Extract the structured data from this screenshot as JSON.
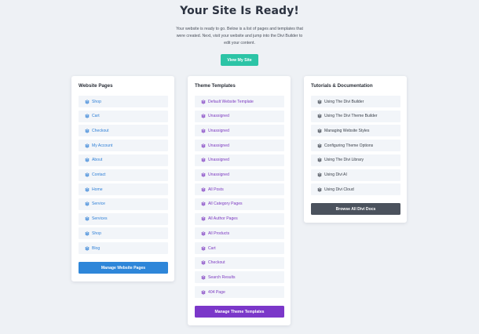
{
  "page": {
    "title": "Your Site Is Ready!",
    "description_line1": "Your website is ready to go. Below is a list of pages and templates that",
    "description_line2": "were created. Next, visit your website and jump into the Divi Builder to",
    "description_line3": "edit your content.",
    "view_site_label": "View My Site"
  },
  "colors": {
    "background": "#eef1f5",
    "accent_teal": "#2cc4a6",
    "pages_blue": "#2e7fd6",
    "templates_purple": "#7d3ac1",
    "docs_dark": "#4b525d"
  },
  "pages_card": {
    "title": "Website Pages",
    "icon": "layers-icon",
    "items": [
      "Shop",
      "Cart",
      "Checkout",
      "My Account",
      "About",
      "Contact",
      "Home",
      "Service",
      "Services",
      "Shop",
      "Blog"
    ],
    "button_label": "Manage Website Pages"
  },
  "templates_card": {
    "title": "Theme Templates",
    "icon": "layers-icon",
    "items": [
      "Default Website Template",
      "Unassigned",
      "Unassigned",
      "Unassigned",
      "Unassigned",
      "Unassigned",
      "All Posts",
      "All Category Pages",
      "All Author Pages",
      "All Products",
      "Cart",
      "Checkout",
      "Search Results",
      "404 Page"
    ],
    "button_label": "Manage Theme Templates"
  },
  "docs_card": {
    "title": "Tutorials & Documentation",
    "icon": "layers-icon",
    "items": [
      "Using The Divi Builder",
      "Using The Divi Theme Builder",
      "Managing Website Styles",
      "Configuring Theme Options",
      "Using The Divi Library",
      "Using Divi AI",
      "Using Divi Cloud"
    ],
    "button_label": "Browse All Divi Docs"
  }
}
